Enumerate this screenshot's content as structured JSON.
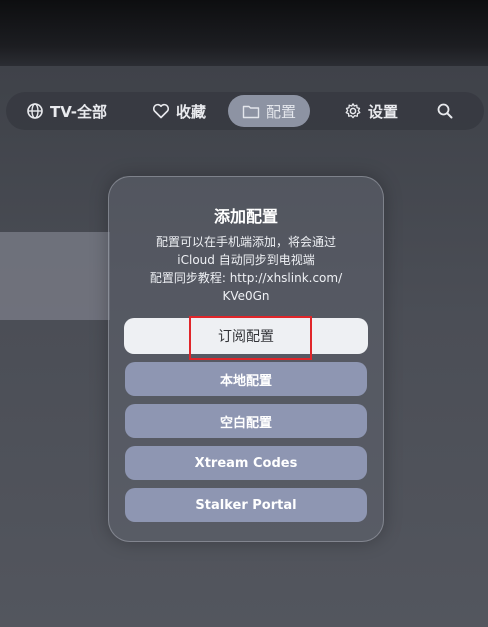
{
  "nav": {
    "items": [
      {
        "label": "TV-全部",
        "icon": "globe-icon"
      },
      {
        "label": "收藏",
        "icon": "heart-icon"
      },
      {
        "label": "配置",
        "icon": "folder-icon",
        "active": true
      },
      {
        "label": "设置",
        "icon": "gear-icon"
      },
      {
        "label": "",
        "icon": "search-icon"
      }
    ]
  },
  "dialog": {
    "title": "添加配置",
    "description_lines": [
      "配置可以在手机端添加，将会通过",
      "iCloud 自动同步到电视端",
      "配置同步教程: http://xhslink.com/",
      "KVe0Gn"
    ],
    "buttons": [
      {
        "label": "订阅配置",
        "focused": true
      },
      {
        "label": "本地配置"
      },
      {
        "label": "空白配置"
      },
      {
        "label": "Xtream Codes"
      },
      {
        "label": "Stalker Portal"
      }
    ]
  },
  "colors": {
    "highlight": "#e0262a",
    "button_secondary": "#8e96b2",
    "button_primary": "#eef0f3",
    "nav_active": "#8d93a3"
  }
}
